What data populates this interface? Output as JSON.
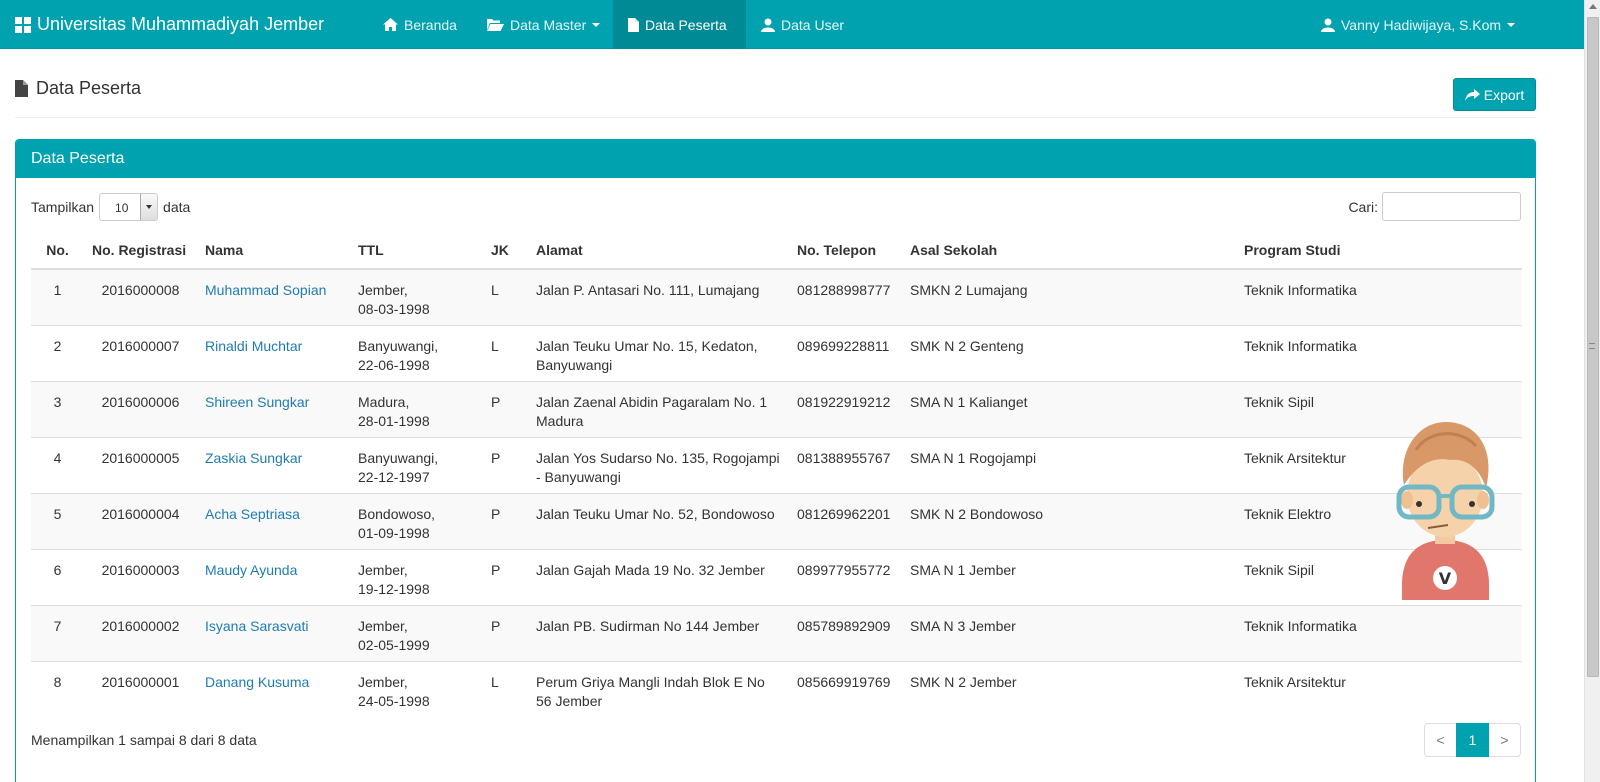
{
  "brand": {
    "title": "Universitas Muhammadiyah Jember",
    "icon": "grid-icon"
  },
  "nav": {
    "home": {
      "label": "Beranda",
      "icon": "home-icon"
    },
    "master": {
      "label": "Data Master",
      "icon": "folder-open-icon"
    },
    "peserta": {
      "label": "Data Peserta",
      "icon": "file-icon"
    },
    "user": {
      "label": "Data User",
      "icon": "user-icon"
    },
    "account": {
      "label": "Vanny Hadiwijaya, S.Kom",
      "icon": "user-icon"
    }
  },
  "colors": {
    "accent": "#00a2b0",
    "link": "#1f7cb3"
  },
  "page": {
    "title": "Data Peserta",
    "export_label": "Export"
  },
  "panel": {
    "title": "Data Peserta",
    "length_before": "Tampilkan",
    "length_value": "10",
    "length_after": "data",
    "search_label": "Cari:",
    "search_placeholder": ""
  },
  "table": {
    "headers": [
      "No.",
      "No. Registrasi",
      "Nama",
      "TTL",
      "JK",
      "Alamat",
      "No. Telepon",
      "Asal Sekolah",
      "Program Studi"
    ],
    "rows": [
      {
        "no": "1",
        "reg": "2016000008",
        "nama": "Muhammad Sopian",
        "ttl1": "Jember,",
        "ttl2": "08-03-1998",
        "jk": "L",
        "alamat": "Jalan P. Antasari No. 111, Lumajang",
        "telp": "081288998777",
        "sekolah": "SMKN 2 Lumajang",
        "prodi": "Teknik Informatika"
      },
      {
        "no": "2",
        "reg": "2016000007",
        "nama": "Rinaldi Muchtar",
        "ttl1": "Banyuwangi,",
        "ttl2": "22-06-1998",
        "jk": "L",
        "alamat": "Jalan Teuku Umar No. 15, Kedaton, Banyuwangi",
        "telp": "089699228811",
        "sekolah": "SMK N 2 Genteng",
        "prodi": "Teknik Informatika"
      },
      {
        "no": "3",
        "reg": "2016000006",
        "nama": "Shireen Sungkar",
        "ttl1": "Madura,",
        "ttl2": "28-01-1998",
        "jk": "P",
        "alamat": "Jalan Zaenal Abidin Pagaralam No. 1 Madura",
        "telp": "081922919212",
        "sekolah": "SMA N 1 Kalianget",
        "prodi": "Teknik Sipil"
      },
      {
        "no": "4",
        "reg": "2016000005",
        "nama": "Zaskia Sungkar",
        "ttl1": "Banyuwangi,",
        "ttl2": "22-12-1997",
        "jk": "P",
        "alamat": "Jalan Yos Sudarso No. 135, Rogojampi - Banyuwangi",
        "telp": "081388955767",
        "sekolah": "SMA N 1 Rogojampi",
        "prodi": "Teknik Arsitektur"
      },
      {
        "no": "5",
        "reg": "2016000004",
        "nama": "Acha Septriasa",
        "ttl1": "Bondowoso,",
        "ttl2": "01-09-1998",
        "jk": "P",
        "alamat": "Jalan Teuku Umar No. 52, Bondowoso",
        "telp": "081269962201",
        "sekolah": "SMK N 2 Bondowoso",
        "prodi": "Teknik Elektro"
      },
      {
        "no": "6",
        "reg": "2016000003",
        "nama": "Maudy Ayunda",
        "ttl1": "Jember,",
        "ttl2": "19-12-1998",
        "jk": "P",
        "alamat": "Jalan Gajah Mada 19 No. 32 Jember",
        "telp": "089977955772",
        "sekolah": "SMA N 1 Jember",
        "prodi": "Teknik Sipil"
      },
      {
        "no": "7",
        "reg": "2016000002",
        "nama": "Isyana Sarasvati",
        "ttl1": "Jember,",
        "ttl2": "02-05-1999",
        "jk": "P",
        "alamat": "Jalan PB. Sudirman No 144 Jember",
        "telp": "085789892909",
        "sekolah": "SMA N 3 Jember",
        "prodi": "Teknik Informatika"
      },
      {
        "no": "8",
        "reg": "2016000001",
        "nama": "Danang Kusuma",
        "ttl1": "Jember,",
        "ttl2": "24-05-1998",
        "jk": "L",
        "alamat": "Perum Griya Mangli Indah Blok E No 56 Jember",
        "telp": "085669919769",
        "sekolah": "SMK N 2 Jember",
        "prodi": "Teknik Arsitektur"
      }
    ]
  },
  "footer": {
    "info": "Menampilkan 1 sampai 8 dari 8 data",
    "prev": "<",
    "page": "1",
    "next": ">"
  },
  "avatar": {
    "letter": "V",
    "icon": "avatar-illustration"
  }
}
